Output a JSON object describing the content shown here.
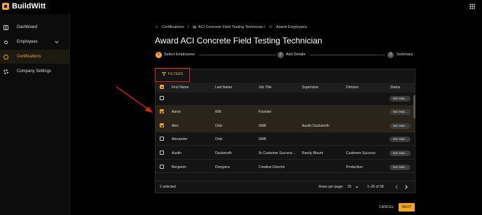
{
  "app": {
    "name": "BuildWitt"
  },
  "sidebar": {
    "items": [
      {
        "label": "Dashboard",
        "icon": "dashboard-icon"
      },
      {
        "label": "Employees",
        "icon": "people-icon"
      },
      {
        "label": "Certifications",
        "icon": "certificate-icon",
        "active": true
      },
      {
        "label": "Company Settings",
        "icon": "gear-icon"
      }
    ]
  },
  "breadcrumb": [
    "Certifications",
    "ACI Concrete Field Testing Technician",
    "Award Employees"
  ],
  "breadcrumb_separator": "/",
  "page": {
    "title": "Award ACI Concrete Field Testing Technician"
  },
  "stepper": {
    "steps": [
      {
        "num": "1",
        "label": "Select Employees",
        "active": true
      },
      {
        "num": "2",
        "label": "Add Details"
      },
      {
        "num": "3",
        "label": "Summary"
      }
    ]
  },
  "filters": {
    "label": "FILTERS"
  },
  "table": {
    "columns": [
      "First Name",
      "Last Name",
      "Job Title",
      "Supervisor",
      "Division",
      "Status"
    ],
    "rows": [
      {
        "first": "",
        "last": "",
        "job": "",
        "supervisor": "",
        "division": "",
        "status": "Not Awar...",
        "checked": false
      },
      {
        "first": "Aaron",
        "last": "Witt",
        "job": "Founder",
        "supervisor": "",
        "division": "",
        "status": "Not Awar...",
        "checked": true
      },
      {
        "first": "Alex",
        "last": "Ortiz",
        "job": "SMB",
        "supervisor": "Austin Duckworth",
        "division": "",
        "status": "Not Awar...",
        "checked": true
      },
      {
        "first": "Alexander",
        "last": "Ortiz",
        "job": "SMB",
        "supervisor": "",
        "division": "",
        "status": "Not Awar...",
        "checked": false
      },
      {
        "first": "Austin",
        "last": "Duckworth",
        "job": "Sr Customer Success ...",
        "supervisor": "Randy Blount",
        "division": "Customer Success",
        "status": "Not Awar...",
        "checked": false
      },
      {
        "first": "Benjamin",
        "last": "Dongarra",
        "job": "Creative Director",
        "supervisor": "",
        "division": "Production",
        "status": "Not Awar...",
        "checked": false
      }
    ]
  },
  "footer": {
    "selected": "2 selected",
    "rows_per_page_label": "Rows per page:",
    "rows_per_page": "25",
    "range": "1–25 of 58"
  },
  "actions": {
    "cancel": "CANCEL",
    "next": "NEXT"
  },
  "colors": {
    "accent": "#f5a623",
    "highlight_box": "#d9261c",
    "annotation_arrow": "#d9261c"
  }
}
